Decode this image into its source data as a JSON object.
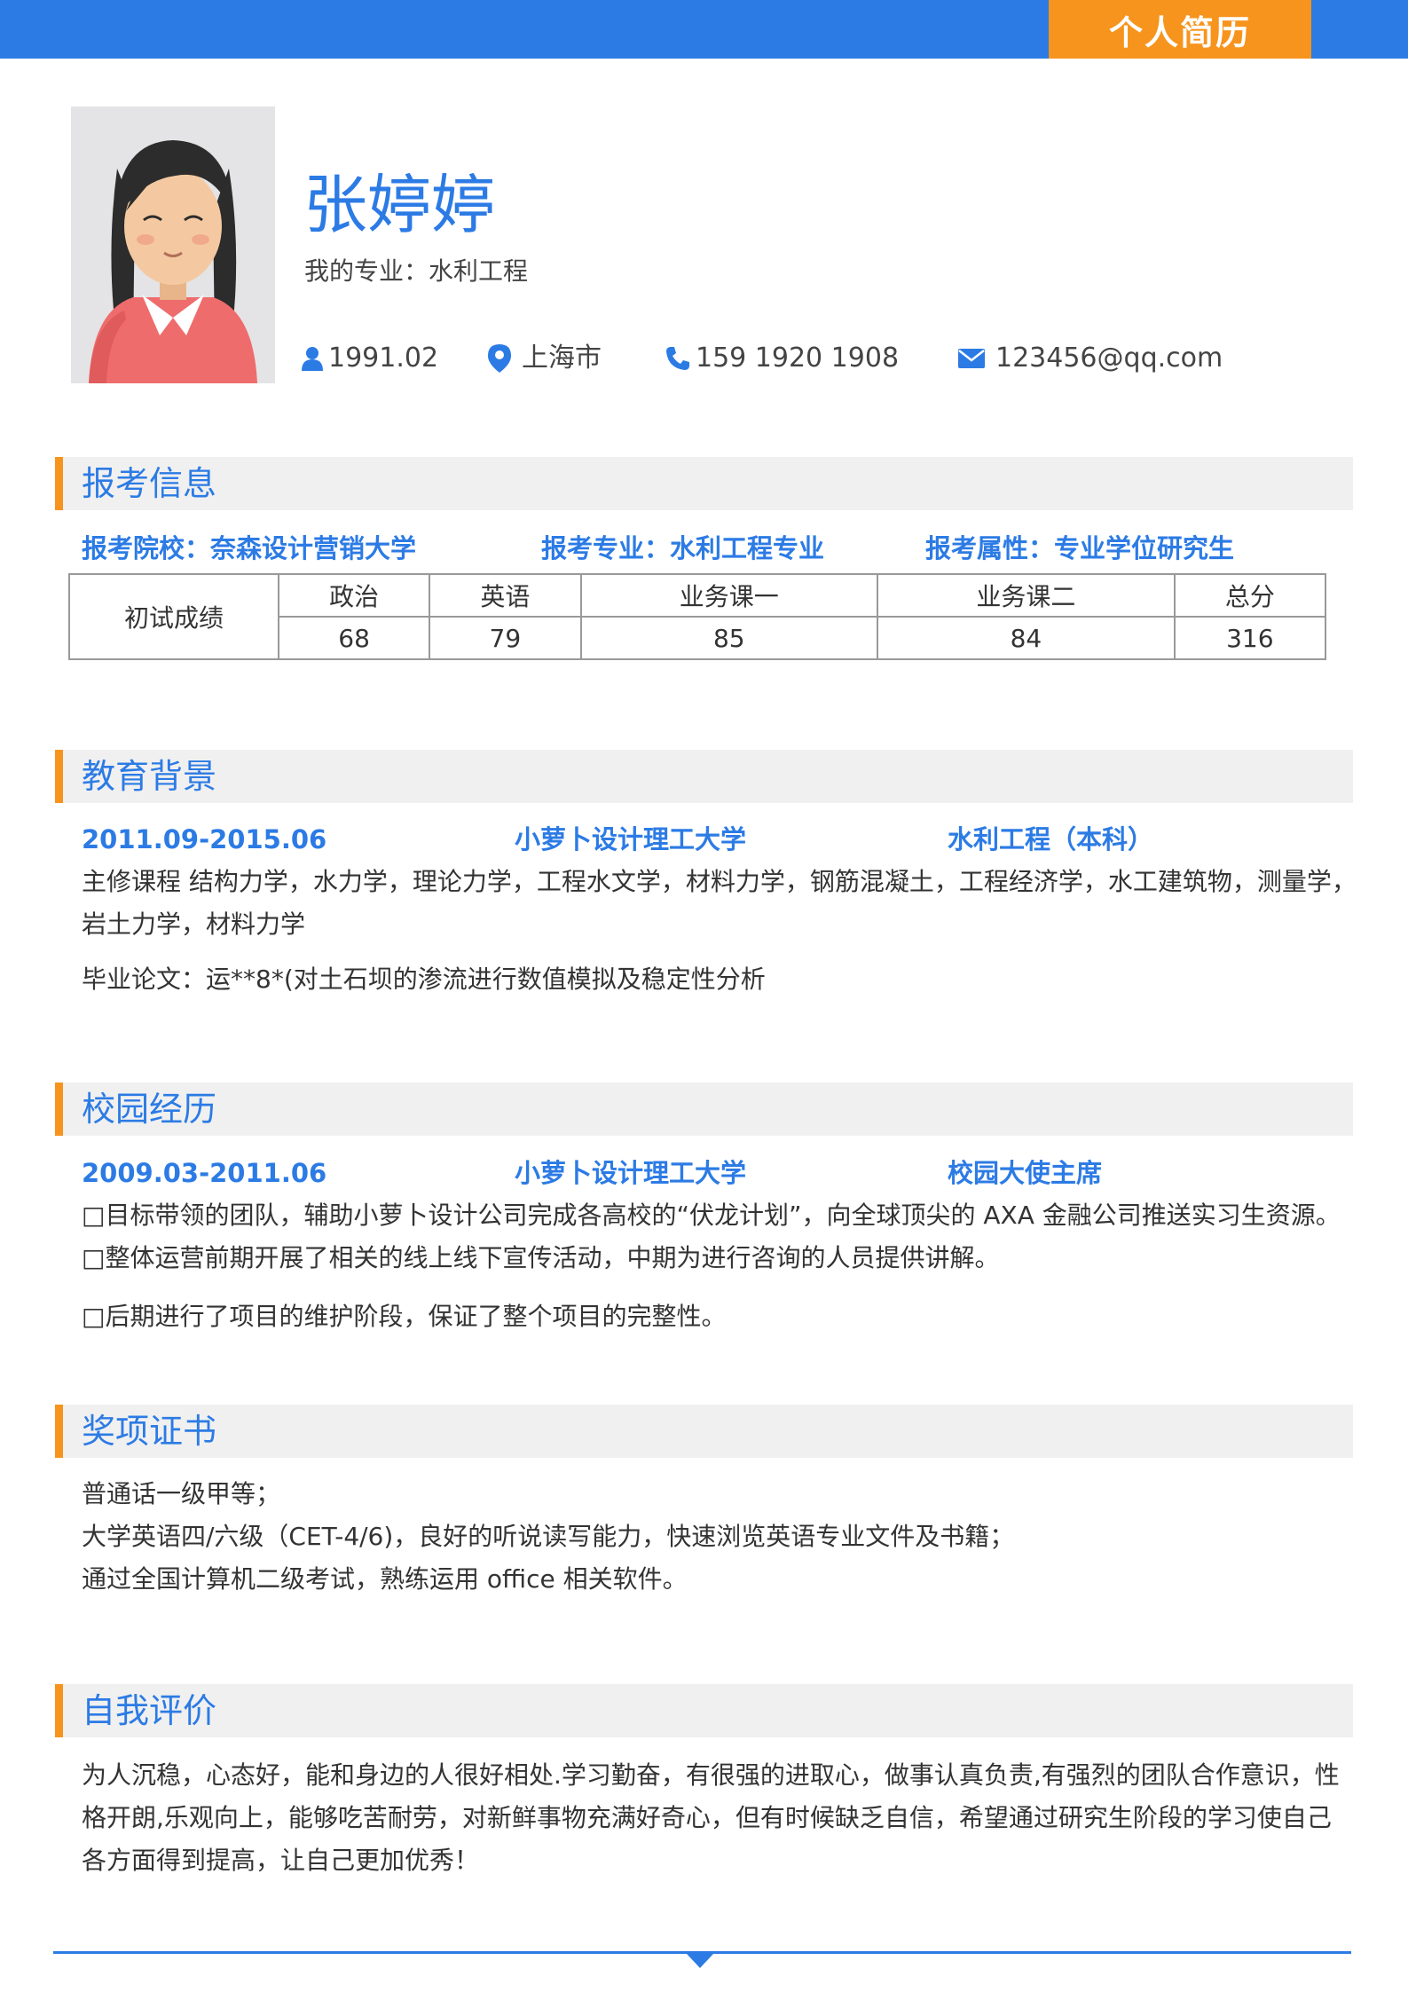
{
  "header": {
    "tag": "个人简历"
  },
  "profile": {
    "name": "张婷婷",
    "major": "我的专业：水利工程",
    "birth": "1991.02",
    "city": "上海市",
    "phone": "159 1920 1908",
    "email": "123456@qq.com"
  },
  "exam": {
    "title": "报考信息",
    "school": "报考院校：奈森设计营销大学",
    "major": "报考专业：水利工程专业",
    "type": "报考属性：专业学位研究生",
    "row_label": "初试成绩",
    "headers": [
      "政治",
      "英语",
      "业务课一",
      "业务课二",
      "总分"
    ],
    "scores": [
      "68",
      "79",
      "85",
      "84",
      "316"
    ]
  },
  "education": {
    "title": "教育背景",
    "period": "2011.09-2015.06",
    "school": "小萝卜设计理工大学",
    "degree": "水利工程（本科）",
    "courses_line1": "主修课程 结构力学，水力学，理论力学，工程水文学，材料力学，钢筋混凝土，工程经济学，水工建筑物，测量学，",
    "courses_line2": "岩土力学，材料力学",
    "thesis": "毕业论文：运**8*(对土石坝的渗流进行数值模拟及稳定性分析"
  },
  "campus": {
    "title": "校园经历",
    "period": "2009.03-2011.06",
    "school": "小萝卜设计理工大学",
    "role": "校园大使主席",
    "items": [
      "目标带领的团队，辅助小萝卜设计公司完成各高校的“伏龙计划”，向全球顶尖的 AXA 金融公司推送实习生资源。",
      "整体运营前期开展了相关的线上线下宣传活动，中期为进行咨询的人员提供讲解。",
      "后期进行了项目的维护阶段，保证了整个项目的完整性。"
    ]
  },
  "awards": {
    "title": "奖项证书",
    "items": [
      "普通话一级甲等；",
      "大学英语四/六级（CET-4/6)，良好的听说读写能力，快速浏览英语专业文件及书籍；",
      "通过全国计算机二级考试，熟练运用 office 相关软件。"
    ]
  },
  "self": {
    "title": "自我评价",
    "text": "为人沉稳，心态好，能和身边的人很好相处.学习勤奋，有很强的进取心，做事认真负责,有强烈的团队合作意识，性格开朗,乐观向上，能够吃苦耐劳，对新鲜事物充满好奇心，但有时候缺乏自信，希望通过研究生阶段的学习使自己各方面得到提高，让自己更加优秀！"
  }
}
